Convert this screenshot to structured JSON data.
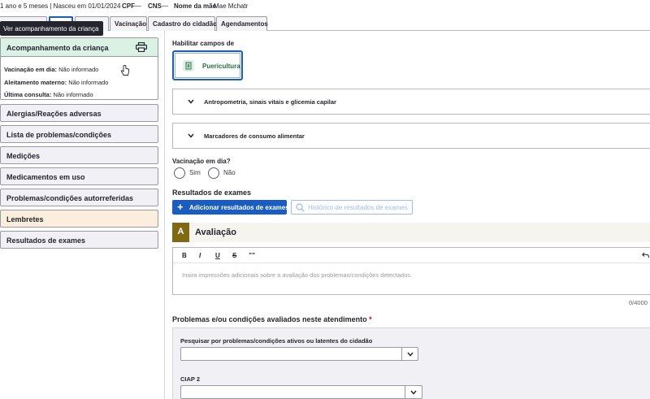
{
  "header": {
    "age_text": "1 ano e 5 meses | Nasceu em 01/01/2024",
    "cpf_label": "CPF",
    "cpf_value": "—",
    "cns_label": "CNS",
    "cns_value": "—",
    "mother_label": "Nome da mãe",
    "mother_value": "Mae Mchatr"
  },
  "tabs": [
    {
      "label": ""
    },
    {
      "label": "Vacinação"
    },
    {
      "label": "Cadastro do cidadão"
    },
    {
      "label": "Agendamentos"
    }
  ],
  "tooltip": "Ver acompanhamento da criança",
  "crianca": {
    "title": "Acompanhamento da criança",
    "rows": [
      {
        "label": "Vacinação em dia:",
        "value": "Não informado"
      },
      {
        "label": "Aleitamento materno:",
        "value": "Não informado"
      },
      {
        "label": "Última consulta:",
        "value": "Não informado"
      }
    ]
  },
  "sidebar": {
    "items": [
      {
        "label": "Alergias/Reações adversas"
      },
      {
        "label": "Lista de problemas/condições"
      },
      {
        "label": "Medições"
      },
      {
        "label": "Medicamentos em uso"
      },
      {
        "label": "Problemas/condições autorreferidas"
      },
      {
        "label": "Lembretes"
      },
      {
        "label": "Resultados de exames"
      }
    ]
  },
  "main": {
    "habilitar_label": "Habilitar campos de",
    "puericultura_label": "Puericultura",
    "accordions": [
      {
        "label": "Antropometria, sinais vitais e glicemia capilar"
      },
      {
        "label": "Marcadores de consumo alimentar"
      }
    ],
    "vacinacao_label": "Vacinação em dia?",
    "radio_sim": "Sim",
    "radio_nao": "Não",
    "resultados_label": "Resultados de exames",
    "add_button": "Adicionar resultados de exames",
    "historico_button": "Histórico de resultados de exames",
    "avaliacao_badge": "A",
    "avaliacao_title": "Avaliação",
    "toolbar": {
      "bold": "B",
      "italic": "I",
      "underline": "U",
      "strike": "S",
      "quote": "””"
    },
    "editor_placeholder": "Insira impressões adicionais sobre a avaliação dos problemas/condições detectados.",
    "counter": "0/4000",
    "problemas_title": "Problemas e/ou condições avaliados neste atendimento",
    "required_mark": "*",
    "pesquisar_label": "Pesquisar por problemas/condições ativos ou latentes do cidadão",
    "ciap_label": "CIAP 2"
  },
  "colors": {
    "primary": "#1b5dbf",
    "crianca_header": "#d9f2e4",
    "lembretes_bg": "#fbeedc",
    "avaliacao_badge": "#7f6913",
    "required": "#d0021b"
  }
}
